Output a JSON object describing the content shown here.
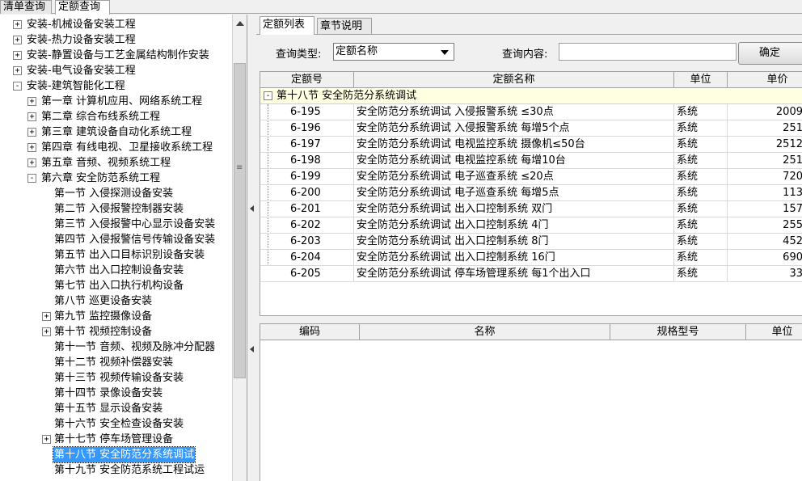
{
  "top_tabs": [
    {
      "label": "清单查询",
      "active": false
    },
    {
      "label": "定额查询",
      "active": true
    }
  ],
  "tree": {
    "items": [
      {
        "label": "安装-机械设备安装工程",
        "level": 0,
        "expander": "+",
        "selected": false
      },
      {
        "label": "安装-热力设备安装工程",
        "level": 0,
        "expander": "+",
        "selected": false
      },
      {
        "label": "安装-静置设备与工艺金属结构制作安装",
        "level": 0,
        "expander": "+",
        "selected": false
      },
      {
        "label": "安装-电气设备安装工程",
        "level": 0,
        "expander": "+",
        "selected": false
      },
      {
        "label": "安装-建筑智能化工程",
        "level": 0,
        "expander": "-",
        "selected": false
      },
      {
        "label": "第一章  计算机应用、网络系统工程",
        "level": 1,
        "expander": "+",
        "selected": false
      },
      {
        "label": "第二章  综合布线系统工程",
        "level": 1,
        "expander": "+",
        "selected": false
      },
      {
        "label": "第三章  建筑设备自动化系统工程",
        "level": 1,
        "expander": "+",
        "selected": false
      },
      {
        "label": "第四章  有线电视、卫星接收系统工程",
        "level": 1,
        "expander": "+",
        "selected": false
      },
      {
        "label": "第五章  音频、视频系统工程",
        "level": 1,
        "expander": "+",
        "selected": false
      },
      {
        "label": "第六章  安全防范系统工程",
        "level": 1,
        "expander": "-",
        "selected": false
      },
      {
        "label": "第一节  入侵探测设备安装",
        "level": 2,
        "expander": "",
        "selected": false
      },
      {
        "label": "第二节  入侵报警控制器安装",
        "level": 2,
        "expander": "",
        "selected": false
      },
      {
        "label": "第三节  入侵报警中心显示设备安装",
        "level": 2,
        "expander": "",
        "selected": false
      },
      {
        "label": "第四节  入侵报警信号传输设备安装",
        "level": 2,
        "expander": "",
        "selected": false
      },
      {
        "label": "第五节  出入口目标识别设备安装",
        "level": 2,
        "expander": "",
        "selected": false
      },
      {
        "label": "第六节  出入口控制设备安装",
        "level": 2,
        "expander": "",
        "selected": false
      },
      {
        "label": "第七节  出入口执行机构设备",
        "level": 2,
        "expander": "",
        "selected": false
      },
      {
        "label": "第八节  巡更设备安装",
        "level": 2,
        "expander": "",
        "selected": false
      },
      {
        "label": "第九节  监控摄像设备",
        "level": 2,
        "expander": "+",
        "selected": false
      },
      {
        "label": "第十节  视频控制设备",
        "level": 2,
        "expander": "+",
        "selected": false
      },
      {
        "label": "第十一节  音频、视频及脉冲分配器",
        "level": 2,
        "expander": "",
        "selected": false
      },
      {
        "label": "第十二节  视频补偿器安装",
        "level": 2,
        "expander": "",
        "selected": false
      },
      {
        "label": "第十三节  视频传输设备安装",
        "level": 2,
        "expander": "",
        "selected": false
      },
      {
        "label": "第十四节  录像设备安装",
        "level": 2,
        "expander": "",
        "selected": false
      },
      {
        "label": "第十五节  显示设备安装",
        "level": 2,
        "expander": "",
        "selected": false
      },
      {
        "label": "第十六节  安全检查设备安装",
        "level": 2,
        "expander": "",
        "selected": false
      },
      {
        "label": "第十七节  停车场管理设备",
        "level": 2,
        "expander": "+",
        "selected": false
      },
      {
        "label": "第十八节  安全防范分系统调试",
        "level": 2,
        "expander": "",
        "selected": true
      },
      {
        "label": "第十九节  安全防范系统工程试运",
        "level": 2,
        "expander": "",
        "selected": false
      }
    ]
  },
  "right": {
    "tabs": [
      {
        "label": "定额列表",
        "active": true
      },
      {
        "label": "章节说明",
        "active": false
      }
    ],
    "query_type_label": "查询类型:",
    "query_type_value": "定额名称",
    "query_content_label": "查询内容:",
    "query_content_value": "",
    "confirm_label": "确定",
    "quota_grid": {
      "columns": [
        "定额号",
        "定额名称",
        "单位",
        "单价"
      ],
      "group_label": "第十八节  安全防范分系统调试",
      "rows": [
        {
          "code": "6-195",
          "name": "安全防范分系统调试  入侵报警系统  ≤30点",
          "unit": "系统",
          "price": "2009"
        },
        {
          "code": "6-196",
          "name": "安全防范分系统调试  入侵报警系统  每增5个点",
          "unit": "系统",
          "price": "251"
        },
        {
          "code": "6-197",
          "name": "安全防范分系统调试  电视监控系统  摄像机≤50台",
          "unit": "系统",
          "price": "2512"
        },
        {
          "code": "6-198",
          "name": "安全防范分系统调试  电视监控系统  每增10台",
          "unit": "系统",
          "price": "251"
        },
        {
          "code": "6-199",
          "name": "安全防范分系统调试  电子巡查系统  ≤20点",
          "unit": "系统",
          "price": "720"
        },
        {
          "code": "6-200",
          "name": "安全防范分系统调试  电子巡查系统  每增5点",
          "unit": "系统",
          "price": "113"
        },
        {
          "code": "6-201",
          "name": "安全防范分系统调试  出入口控制系统  双门",
          "unit": "系统",
          "price": "157"
        },
        {
          "code": "6-202",
          "name": "安全防范分系统调试  出入口控制系统  4门",
          "unit": "系统",
          "price": "255"
        },
        {
          "code": "6-203",
          "name": "安全防范分系统调试  出入口控制系统  8门",
          "unit": "系统",
          "price": "452"
        },
        {
          "code": "6-204",
          "name": "安全防范分系统调试  出入口控制系统  16门",
          "unit": "系统",
          "price": "690"
        },
        {
          "code": "6-205",
          "name": "安全防范分系统调试  停车场管理系统  每1个出入口",
          "unit": "系统",
          "price": "33"
        }
      ]
    },
    "material_grid": {
      "columns": [
        "编码",
        "名称",
        "规格型号",
        "单位"
      ]
    }
  }
}
